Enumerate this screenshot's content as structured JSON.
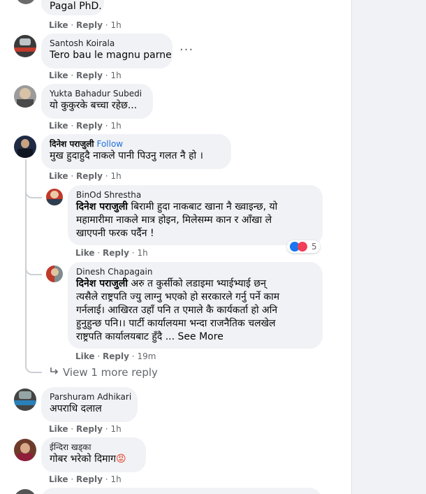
{
  "actions": {
    "like": "Like",
    "reply": "Reply",
    "sep": "·"
  },
  "comments": [
    {
      "name": "",
      "text": "Pagal PhD.",
      "time": "1h"
    },
    {
      "name": "Santosh Koirala",
      "text": "Tero bau le magnu parne",
      "time": "1h",
      "more": "···"
    },
    {
      "name": "Yukta Bahadur Subedi",
      "text": "यो कुकुरके बच्चा रहेछ...",
      "time": "1h"
    },
    {
      "name": "दिनेश पराजुली",
      "follow": "Follow",
      "text": "मुख हुदाहुदै नाकले पानी पिउनु गलत नै हो ।",
      "time": "1h"
    }
  ],
  "replies": [
    {
      "name": "BinOd Shrestha",
      "mention": "दिनेश पराजुली",
      "lines": [
        " बिरामी हुदा नाकबाट खाना नै ख्वाइन्छ, यो",
        "महामारीमा नाकले मात्र होइन, मिलेसम्म कान र आँखा ले",
        "खाएपनी फरक पर्दैन !"
      ],
      "time": "1h",
      "reaction_count": "5"
    },
    {
      "name": "Dinesh Chapagain",
      "mention": "दिनेश पराजुली",
      "lines": [
        " अरु त कुर्सीको लडाइमा भ्याईभ्याई छन्",
        "त्यसैले राष्ट्रपति ज्यु लाग्नु भएको हो सरकारले गर्नु पर्ने काम",
        "गर्नलाई। आखिरत उहाँ पनि त एमाले कै कार्यकर्ता हो अनि",
        "हुनुहुन्छ पनि।। पार्टी कार्यालयमा भन्दा राजनैतिक चलखेल",
        "राष्ट्रपति कार्यालयबाट हुँदै ..."
      ],
      "see_more": "See More",
      "time": "19m"
    }
  ],
  "view_more": "View 1 more reply",
  "comments2": [
    {
      "name": "Parshuram Adhikari",
      "text": "अपराधि दलाल",
      "time": "1h"
    },
    {
      "name": "ईन्दिरा खड्का",
      "text": "गोबर भरेको दिमाग",
      "emoji": "😡",
      "time": "1h"
    }
  ]
}
